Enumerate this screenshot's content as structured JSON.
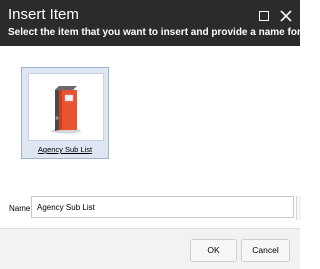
{
  "dialog": {
    "title": "Insert Item",
    "subtitle": "Select the item that you want to insert and provide a name for it."
  },
  "items": [
    {
      "label": "Agency Sub List",
      "icon": "binder-icon",
      "selected": true
    }
  ],
  "name_field": {
    "label": "Name:",
    "value": "Agency Sub List"
  },
  "buttons": {
    "ok": "OK",
    "cancel": "Cancel"
  },
  "colors": {
    "titlebar": "#2b2b2b",
    "selection": "#dde6f2",
    "binder_body": "#e8542f",
    "binder_spine": "#4a4a4a"
  }
}
